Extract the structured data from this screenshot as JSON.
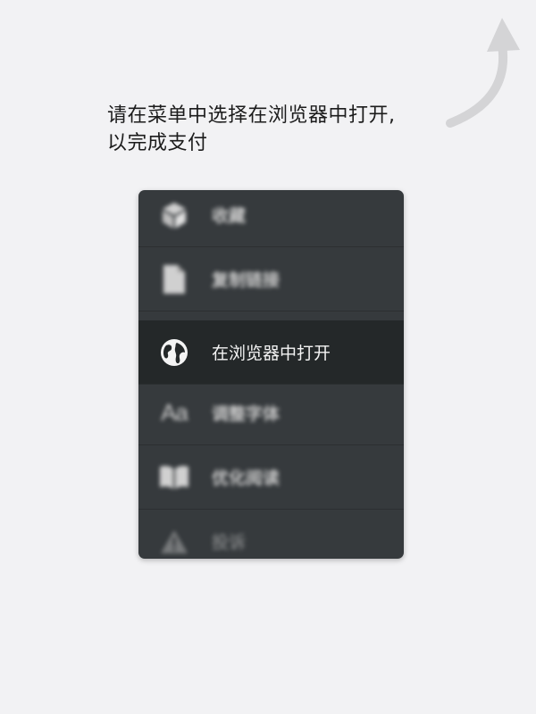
{
  "instruction": {
    "line1": "请在菜单中选择在浏览器中打开,",
    "line2": "以完成支付"
  },
  "menu": {
    "items": [
      {
        "label": "收藏",
        "icon": "cube-icon"
      },
      {
        "label": "复制链接",
        "icon": "document-icon"
      },
      {
        "label": "在浏览器中打开",
        "icon": "globe-icon",
        "highlighted": true
      },
      {
        "label": "调整字体",
        "icon": "font-size-icon",
        "glyph": "Aa"
      },
      {
        "label": "优化阅读",
        "icon": "book-icon"
      },
      {
        "label": "投诉",
        "icon": "warning-icon"
      }
    ]
  },
  "colors": {
    "background": "#f2f2f4",
    "menu_background": "#363a3d",
    "menu_highlight": "#242829",
    "arrow": "#d4d4d6"
  }
}
